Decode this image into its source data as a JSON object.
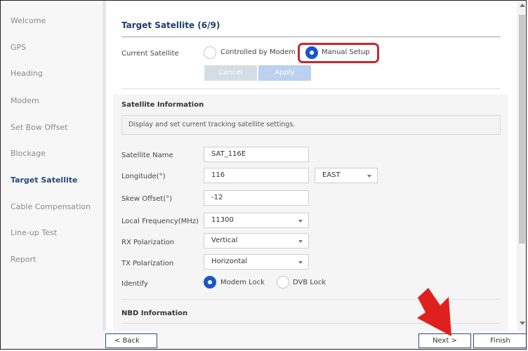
{
  "sidebar": {
    "items": [
      {
        "label": "Welcome"
      },
      {
        "label": "GPS"
      },
      {
        "label": "Heading"
      },
      {
        "label": "Modem"
      },
      {
        "label": "Set Bow Offset"
      },
      {
        "label": "Blockage"
      },
      {
        "label": "Target Satellite"
      },
      {
        "label": "Cable Compensation"
      },
      {
        "label": "Line-up Test"
      },
      {
        "label": "Report"
      }
    ],
    "active_index": 6
  },
  "page": {
    "title": "Target Satellite (6/9)",
    "current_satellite_label": "Current Satellite",
    "mode_options": {
      "controlled": "Controlled by Modem",
      "manual": "Manual Setup"
    },
    "mode_selected": "manual",
    "cancel_label": "Cancel",
    "apply_label": "Apply"
  },
  "satellite_info": {
    "title": "Satellite Information",
    "description": "Display and set current tracking satellite settings.",
    "fields": {
      "name": {
        "label": "Satellite Name",
        "value": "SAT_116E"
      },
      "longitude": {
        "label": "Longitude(°)",
        "value": "116",
        "hemisphere": "EAST"
      },
      "skew": {
        "label": "Skew Offset(°)",
        "value": "-12"
      },
      "local_freq": {
        "label": "Local Frequency(MHz)",
        "value": "11300"
      },
      "rx_pol": {
        "label": "RX Polarization",
        "value": "Vertical"
      },
      "tx_pol": {
        "label": "TX Polarization",
        "value": "Horizontal"
      },
      "identify": {
        "label": "Identify",
        "options": {
          "modem": "Modem Lock",
          "dvb": "DVB Lock"
        },
        "selected": "modem"
      }
    }
  },
  "nbd_info": {
    "title": "NBD Information"
  },
  "footer": {
    "back": "< Back",
    "next": "Next >",
    "finish": "Finish"
  },
  "colors": {
    "accent": "#1a56c9",
    "highlight": "#c8282d",
    "arrow": "#e0201c",
    "active_nav": "#2a4a7a"
  }
}
